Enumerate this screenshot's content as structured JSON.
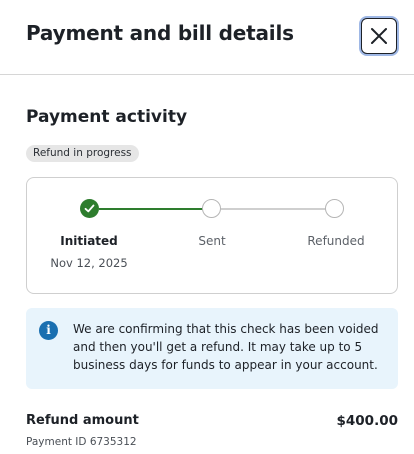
{
  "header": {
    "title": "Payment and bill details",
    "close_icon": "close-icon"
  },
  "activity": {
    "title": "Payment activity",
    "status_badge": "Refund in progress",
    "steps": [
      {
        "label": "Initiated",
        "date": "Nov 12, 2025",
        "state": "complete"
      },
      {
        "label": "Sent",
        "state": "pending"
      },
      {
        "label": "Refunded",
        "state": "pending"
      }
    ]
  },
  "info": {
    "icon": "info-icon",
    "text": "We are confirming that this check has been voided and then you'll get a refund. It may take up to 5 business days for funds to appear in your account."
  },
  "refund": {
    "label": "Refund amount",
    "amount": "$400.00",
    "payment_id": "Payment ID 6735312"
  },
  "colors": {
    "complete_green": "#2e7d2e",
    "info_background": "#e8f4fc",
    "info_icon_blue": "#1a6fb0"
  }
}
